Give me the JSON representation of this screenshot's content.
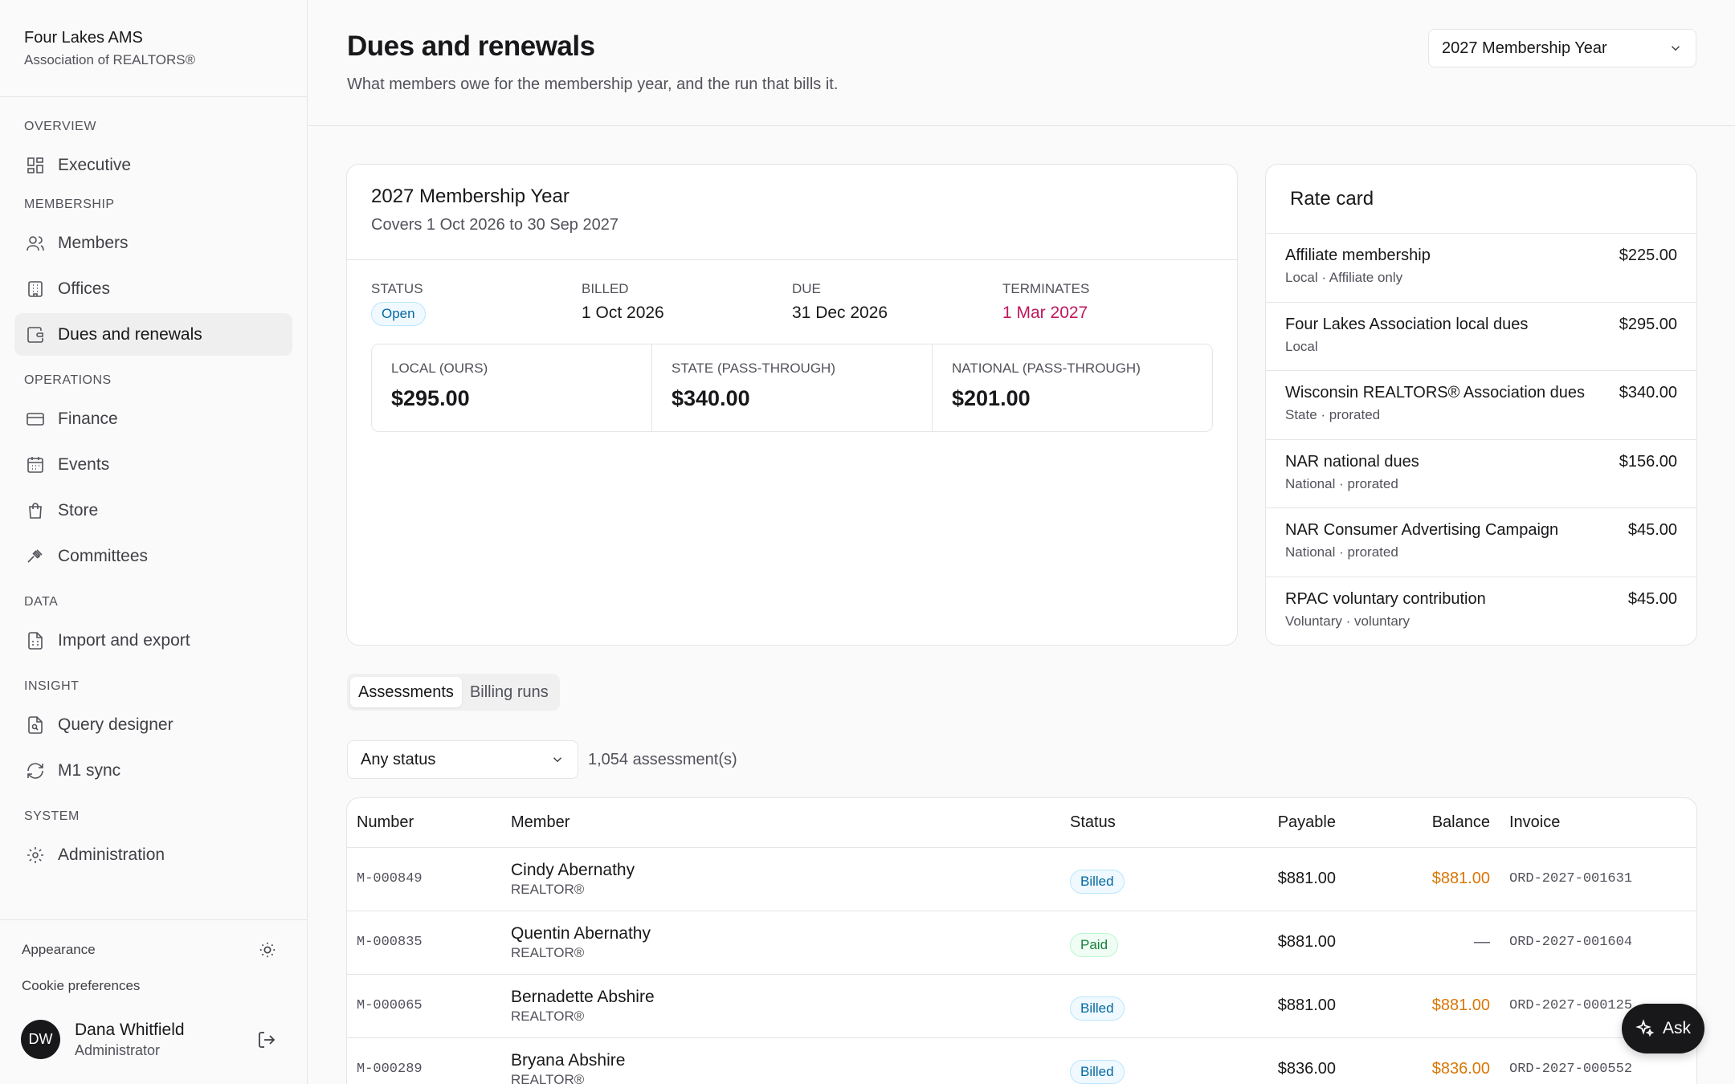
{
  "brand": {
    "name": "Four Lakes AMS",
    "sub": "Association of REALTORS®"
  },
  "nav": {
    "overview": "OVERVIEW",
    "executive": "Executive",
    "membership": "MEMBERSHIP",
    "members": "Members",
    "offices": "Offices",
    "dues": "Dues and renewals",
    "operations": "OPERATIONS",
    "finance": "Finance",
    "events": "Events",
    "store": "Store",
    "committees": "Committees",
    "data": "DATA",
    "import": "Import and export",
    "insight": "INSIGHT",
    "query": "Query designer",
    "m1": "M1 sync",
    "system": "SYSTEM",
    "admin": "Administration"
  },
  "footer": {
    "appearance": "Appearance",
    "cookies": "Cookie preferences",
    "user_initials": "DW",
    "user_name": "Dana Whitfield",
    "user_role": "Administrator"
  },
  "header": {
    "title": "Dues and renewals",
    "subtitle": "What members owe for the membership year, and the run that bills it.",
    "year_select": "2027 Membership Year"
  },
  "year_card": {
    "title": "2027 Membership Year",
    "covers": "Covers 1 Oct 2026 to 30 Sep 2027",
    "status_label": "STATUS",
    "status": "Open",
    "billed_label": "BILLED",
    "billed": "1 Oct 2026",
    "due_label": "DUE",
    "due": "31 Dec 2026",
    "terminates_label": "TERMINATES",
    "terminates": "1 Mar 2027",
    "local_label": "LOCAL (OURS)",
    "local": "$295.00",
    "state_label": "STATE (PASS-THROUGH)",
    "state": "$340.00",
    "national_label": "NATIONAL (PASS-THROUGH)",
    "national": "$201.00"
  },
  "rate_card": {
    "title": "Rate card",
    "rows": [
      {
        "name": "Affiliate membership",
        "meta": "Local · Affiliate only",
        "price": "$225.00"
      },
      {
        "name": "Four Lakes Association local dues",
        "meta": "Local",
        "price": "$295.00"
      },
      {
        "name": "Wisconsin REALTORS® Association dues",
        "meta": "State · prorated",
        "price": "$340.00"
      },
      {
        "name": "NAR national dues",
        "meta": "National · prorated",
        "price": "$156.00"
      },
      {
        "name": "NAR Consumer Advertising Campaign",
        "meta": "National · prorated",
        "price": "$45.00"
      },
      {
        "name": "RPAC voluntary contribution",
        "meta": "Voluntary · voluntary",
        "price": "$45.00"
      }
    ]
  },
  "tabs": {
    "assessments": "Assessments",
    "billing_runs": "Billing runs"
  },
  "filter": {
    "status": "Any status",
    "count": "1,054 assessment(s)"
  },
  "table": {
    "headers": {
      "number": "Number",
      "member": "Member",
      "status": "Status",
      "payable": "Payable",
      "balance": "Balance",
      "invoice": "Invoice"
    },
    "rows": [
      {
        "number": "M-000849",
        "name": "Cindy Abernathy",
        "type": "REALTOR®",
        "status": "Billed",
        "payable": "$881.00",
        "balance": "$881.00",
        "invoice": "ORD-2027-001631"
      },
      {
        "number": "M-000835",
        "name": "Quentin Abernathy",
        "type": "REALTOR®",
        "status": "Paid",
        "payable": "$881.00",
        "balance": "—",
        "invoice": "ORD-2027-001604"
      },
      {
        "number": "M-000065",
        "name": "Bernadette Abshire",
        "type": "REALTOR®",
        "status": "Billed",
        "payable": "$881.00",
        "balance": "$881.00",
        "invoice": "ORD-2027-000125"
      },
      {
        "number": "M-000289",
        "name": "Bryana Abshire",
        "type": "REALTOR®",
        "status": "Billed",
        "payable": "$836.00",
        "balance": "$836.00",
        "invoice": "ORD-2027-000552"
      }
    ]
  },
  "ask": "Ask",
  "colors": {
    "accent_red": "#be185d",
    "balance_orange": "#d97706",
    "billed_blue": "#0369a1",
    "paid_green": "#15803d"
  }
}
